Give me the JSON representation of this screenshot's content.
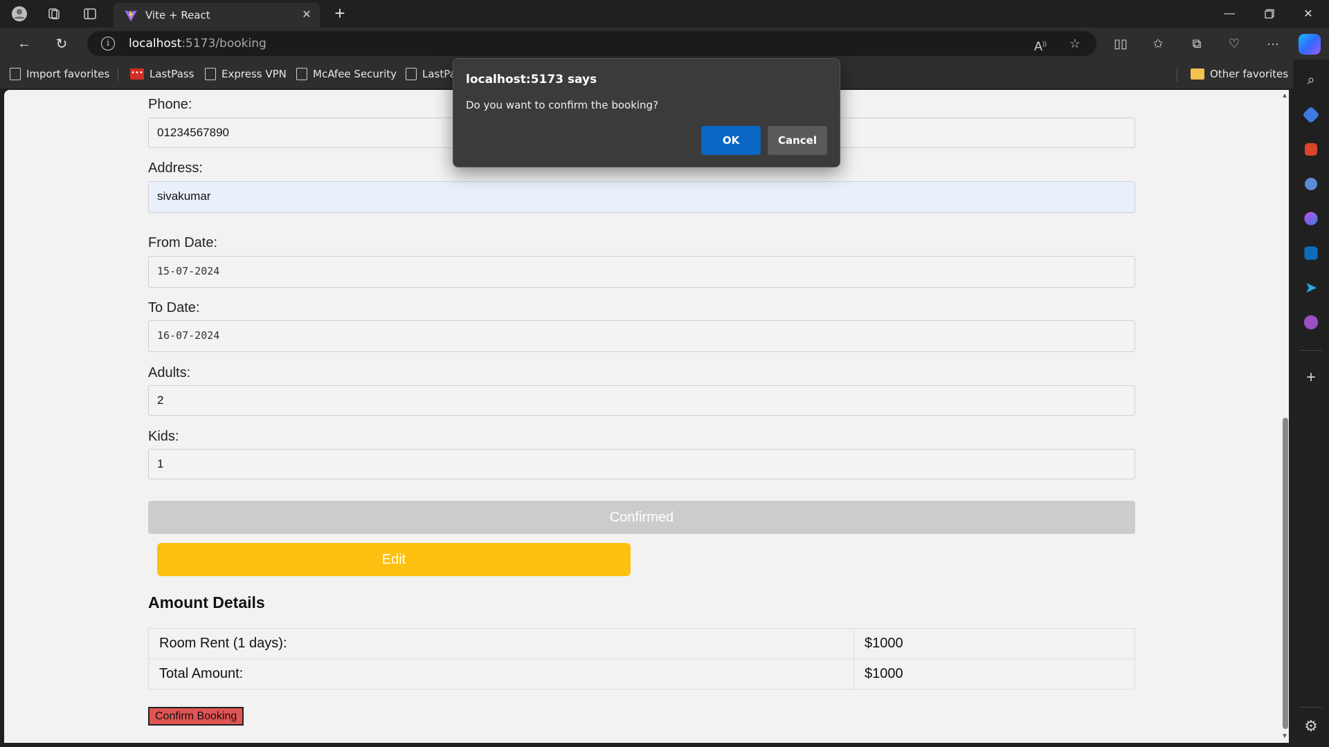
{
  "browser": {
    "tab_title": "Vite + React",
    "url_host": "localhost",
    "url_path": ":5173/booking",
    "favorites": [
      {
        "label": "Import favorites",
        "icon": "import-icon"
      },
      {
        "label": "LastPass",
        "icon": "lastpass-icon"
      },
      {
        "label": "Express VPN",
        "icon": "page-icon"
      },
      {
        "label": "McAfee Security",
        "icon": "page-icon"
      },
      {
        "label": "LastPa",
        "icon": "page-icon"
      }
    ],
    "other_favorites": "Other favorites",
    "lastpass_glyph": "•••"
  },
  "form": {
    "phone_label": "Phone:",
    "phone_value": "01234567890",
    "address_label": "Address:",
    "address_value": "sivakumar",
    "from_date_label": "From Date:",
    "from_date_value": "15-07-2024",
    "to_date_label": "To Date:",
    "to_date_value": "16-07-2024",
    "adults_label": "Adults:",
    "adults_value": "2",
    "kids_label": "Kids:",
    "kids_value": "1",
    "confirmed_label": "Confirmed",
    "edit_label": "Edit"
  },
  "amount": {
    "heading": "Amount Details",
    "rows": [
      {
        "label": "Room Rent (1 days):",
        "value": "$1000"
      },
      {
        "label": "Total Amount:",
        "value": "$1000"
      }
    ],
    "confirm_button": "Confirm Booking"
  },
  "dialog": {
    "title": "localhost:5173 says",
    "message": "Do you want to confirm the booking?",
    "ok": "OK",
    "cancel": "Cancel"
  },
  "colors": {
    "edit_button": "#fdc010",
    "confirm_booking_button": "#e05454",
    "dialog_ok": "#0a67c4",
    "confirmed_button": "#cccccc"
  }
}
